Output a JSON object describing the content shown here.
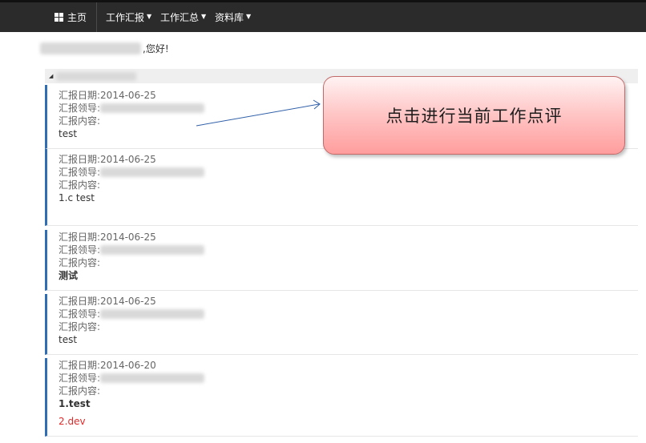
{
  "topbar": {
    "home_label": "主页",
    "menus": [
      {
        "label": "工作汇报"
      },
      {
        "label": "工作汇总"
      },
      {
        "label": "资料库"
      }
    ]
  },
  "greeting": {
    "suffix": ",您好!"
  },
  "reports": [
    {
      "date_line": "汇报日期:2014-06-25",
      "leader_label": "汇报领导:",
      "content_label": "汇报内容:",
      "content_lines": [
        {
          "text": "test",
          "style": "normal"
        }
      ]
    },
    {
      "date_line": "汇报日期:2014-06-25",
      "leader_label": "汇报领导:",
      "content_label": "汇报内容:",
      "content_lines": [
        {
          "text": "1.c test",
          "style": "normal"
        }
      ]
    },
    {
      "date_line": "汇报日期:2014-06-25",
      "leader_label": "汇报领导:",
      "content_label": "汇报内容:",
      "content_lines": [
        {
          "text": "测试",
          "style": "bold"
        }
      ]
    },
    {
      "date_line": "汇报日期:2014-06-25",
      "leader_label": "汇报领导:",
      "content_label": "汇报内容:",
      "content_lines": [
        {
          "text": "test",
          "style": "normal"
        }
      ]
    },
    {
      "date_line": "汇报日期:2014-06-20",
      "leader_label": "汇报领导:",
      "content_label": "汇报内容:",
      "content_lines": [
        {
          "text": "1.test",
          "style": "bold"
        },
        {
          "text": "2.dev",
          "style": "red"
        }
      ]
    }
  ],
  "callout": {
    "text": "点击进行当前工作点评"
  },
  "colors": {
    "topbar_bg": "#2b2b2b",
    "accent_border": "#2f6db5",
    "callout_fill": "#ffb3b3",
    "red_text": "#e02b2b"
  }
}
